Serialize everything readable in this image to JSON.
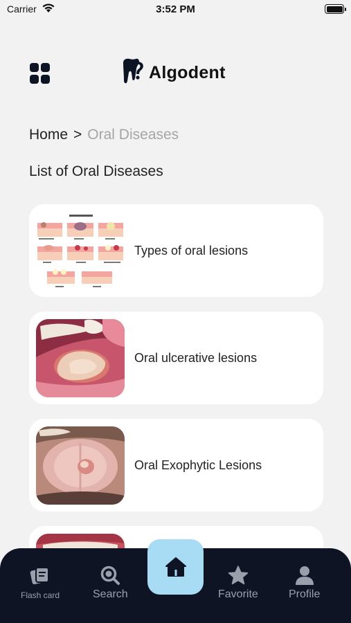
{
  "status_bar": {
    "carrier": "Carrier",
    "time": "3:52 PM"
  },
  "header": {
    "app_name": "Algodent",
    "menu_icon": "grid-menu-icon",
    "logo_icon": "tooth-question-logo"
  },
  "breadcrumb": {
    "home": "Home",
    "separator": ">",
    "current": "Oral Diseases"
  },
  "page_title": "List of Oral Diseases",
  "cards": [
    {
      "label": "Types of oral lesions",
      "thumb": "lesions-diagram"
    },
    {
      "label": "Oral ulcerative lesions",
      "thumb": "ulcer-photo"
    },
    {
      "label": "Oral Exophytic Lesions",
      "thumb": "exophytic-photo"
    },
    {
      "label": "",
      "thumb": "mouth-photo"
    }
  ],
  "bottom_nav": {
    "items": [
      {
        "label": "Flash card",
        "icon": "flash-card-icon"
      },
      {
        "label": "Search",
        "icon": "search-icon"
      },
      {
        "label": "Home",
        "icon": "home-icon",
        "active": true
      },
      {
        "label": "Favorite",
        "icon": "star-icon"
      },
      {
        "label": "Profile",
        "icon": "person-icon"
      }
    ]
  },
  "colors": {
    "background": "#f2f2f2",
    "nav_background": "#0e1424",
    "active_home": "#a7dcf4",
    "muted_text": "#a5a5a5"
  }
}
